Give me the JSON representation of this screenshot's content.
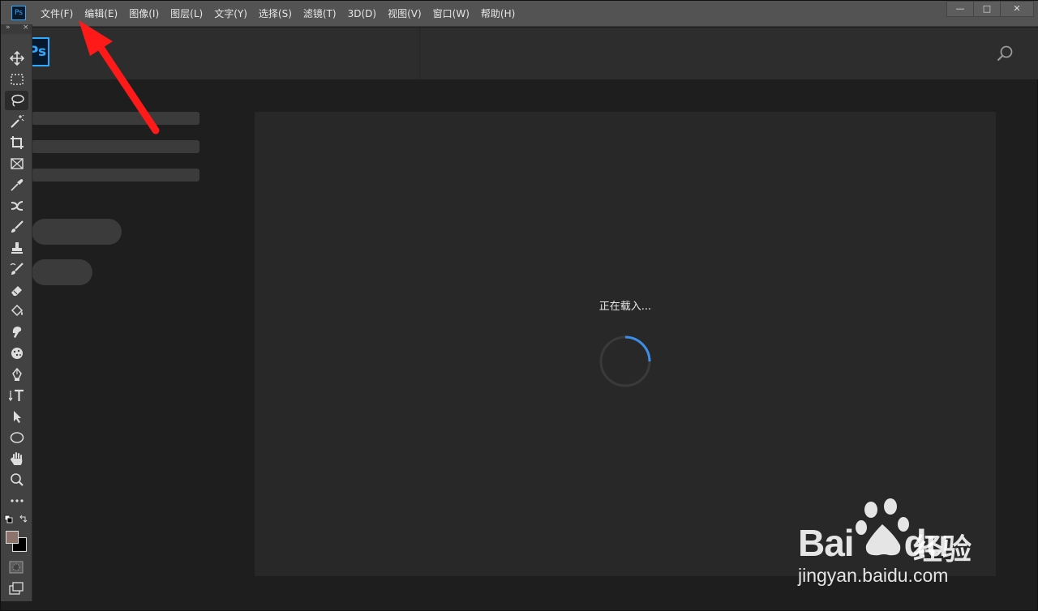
{
  "app": {
    "logo_text": "Ps",
    "badge_text": "Ps"
  },
  "menu": {
    "items": [
      "文件(F)",
      "编辑(E)",
      "图像(I)",
      "图层(L)",
      "文字(Y)",
      "选择(S)",
      "滤镜(T)",
      "3D(D)",
      "视图(V)",
      "窗口(W)",
      "帮助(H)"
    ]
  },
  "window_controls": {
    "minimize": "—",
    "maximize": "□",
    "close": "✕"
  },
  "toolbar": {
    "collapse_glyph": "»",
    "close_glyph": "×",
    "tools": [
      "move",
      "rectangular-marquee",
      "lasso",
      "magic-wand",
      "crop",
      "frame",
      "eyedropper",
      "spot-healing",
      "brush",
      "clone-stamp",
      "history-brush",
      "eraser",
      "paint-bucket",
      "smudge",
      "sponge",
      "pen",
      "type",
      "path-selection",
      "ellipse",
      "hand",
      "zoom",
      "more"
    ],
    "active_tool": "lasso",
    "foreground_color": "#8c736c",
    "background_color": "#000000"
  },
  "main": {
    "loading_text": "正在载入..."
  },
  "colors": {
    "accent": "#31a8ff",
    "spinner": "#3d8ee8",
    "arrow": "#ff1a1a"
  },
  "watermark": {
    "brand": "Bai",
    "brand_suffix": "du",
    "cn": "经验",
    "url": "jingyan.baidu.com"
  }
}
